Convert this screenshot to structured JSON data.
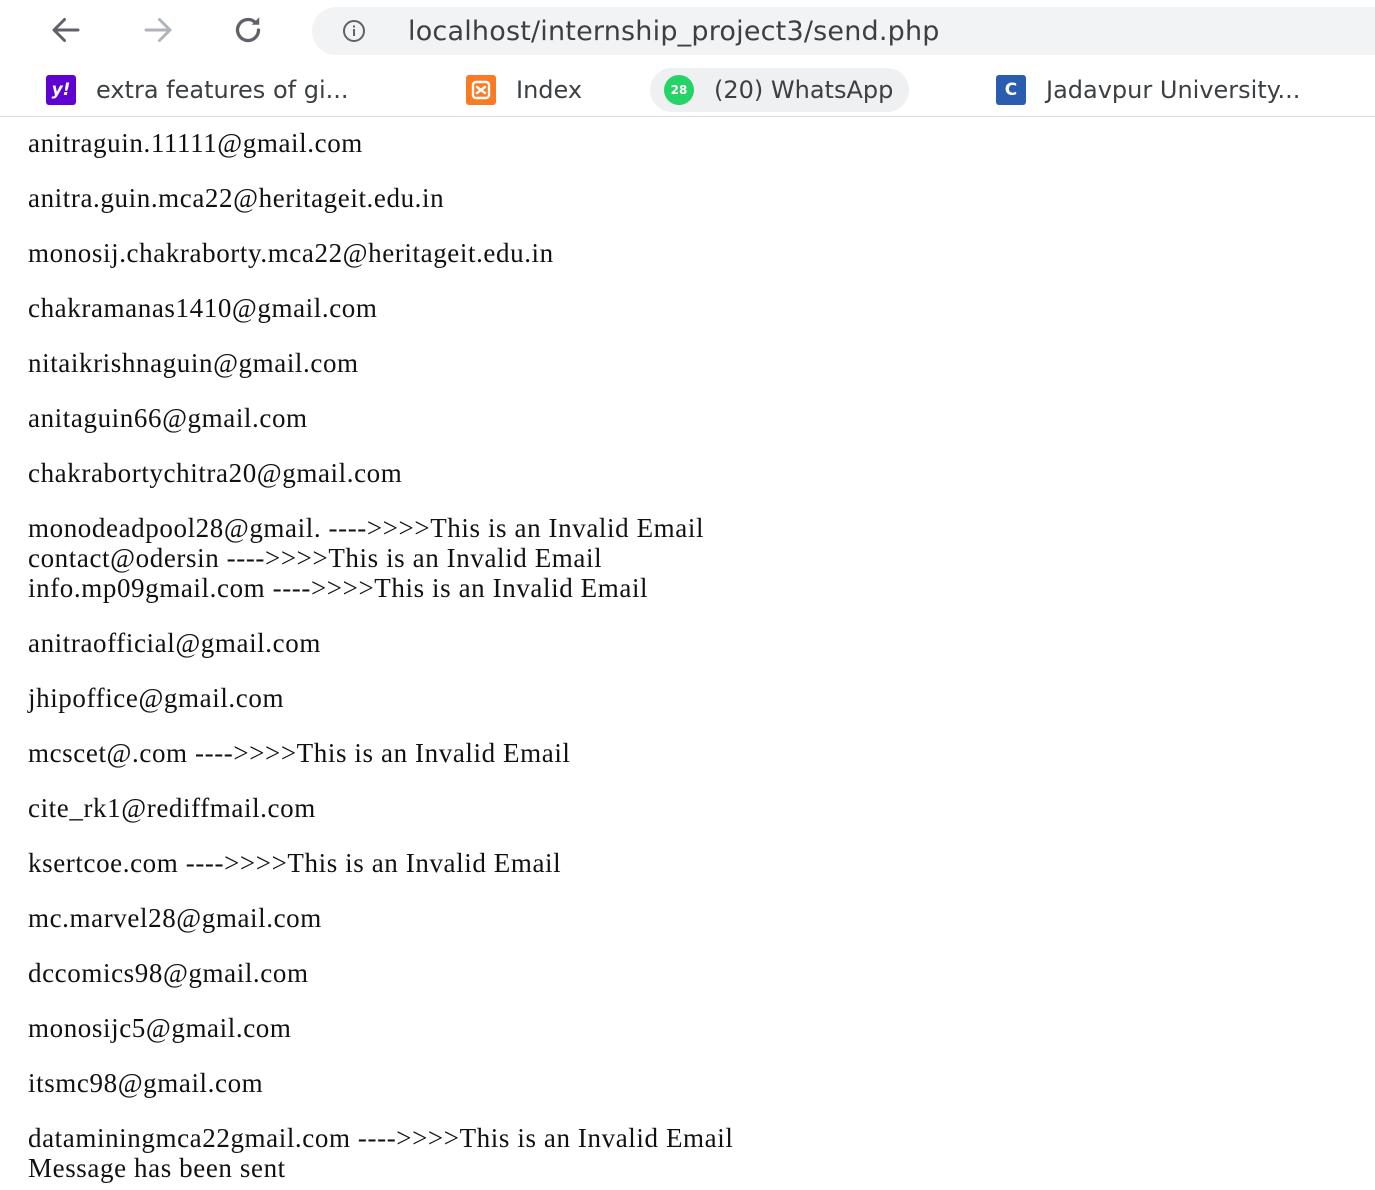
{
  "browser": {
    "url": "localhost/internship_project3/send.php",
    "bookmarks": [
      {
        "label": "extra features of gi...",
        "icon": "yahoo-icon",
        "icon_text": "y!",
        "color": "#5f01d1"
      },
      {
        "label": "Index",
        "icon": "xampp-icon",
        "icon_text": "",
        "color": "#fb7a24"
      },
      {
        "label": "(20) WhatsApp",
        "icon": "whatsapp-icon",
        "icon_text": "28",
        "color": "#25d366"
      },
      {
        "label": "Jadavpur University...",
        "icon": "c-icon",
        "icon_text": "C",
        "color": "#2a5db0"
      }
    ]
  },
  "output": {
    "lines": [
      {
        "text": "anitraguin.11111@gmail.com",
        "gap": false
      },
      {
        "text": "anitra.guin.mca22@heritageit.edu.in",
        "gap": true
      },
      {
        "text": "monosij.chakraborty.mca22@heritageit.edu.in",
        "gap": true
      },
      {
        "text": "chakramanas1410@gmail.com",
        "gap": true
      },
      {
        "text": "nitaikrishnaguin@gmail.com",
        "gap": true
      },
      {
        "text": "anitaguin66@gmail.com",
        "gap": true
      },
      {
        "text": "chakrabortychitra20@gmail.com",
        "gap": true
      },
      {
        "text": "monodeadpool28@gmail. ---->>>>This is an Invalid Email",
        "gap": true
      },
      {
        "text": "contact@odersin ---->>>>This is an Invalid Email",
        "gap": false
      },
      {
        "text": "info.mp09gmail.com ---->>>>This is an Invalid Email",
        "gap": false
      },
      {
        "text": "anitraofficial@gmail.com",
        "gap": true
      },
      {
        "text": "jhipoffice@gmail.com",
        "gap": true
      },
      {
        "text": "mcscet@.com ---->>>>This is an Invalid Email",
        "gap": true
      },
      {
        "text": "cite_rk1@rediffmail.com",
        "gap": true
      },
      {
        "text": "ksertcoe.com ---->>>>This is an Invalid Email",
        "gap": true
      },
      {
        "text": "mc.marvel28@gmail.com",
        "gap": true
      },
      {
        "text": "dccomics98@gmail.com",
        "gap": true
      },
      {
        "text": "monosijc5@gmail.com",
        "gap": true
      },
      {
        "text": "itsmc98@gmail.com",
        "gap": true
      },
      {
        "text": "dataminingmca22gmail.com ---->>>>This is an Invalid Email",
        "gap": true
      },
      {
        "text": "Message has been sent",
        "gap": false
      }
    ]
  }
}
